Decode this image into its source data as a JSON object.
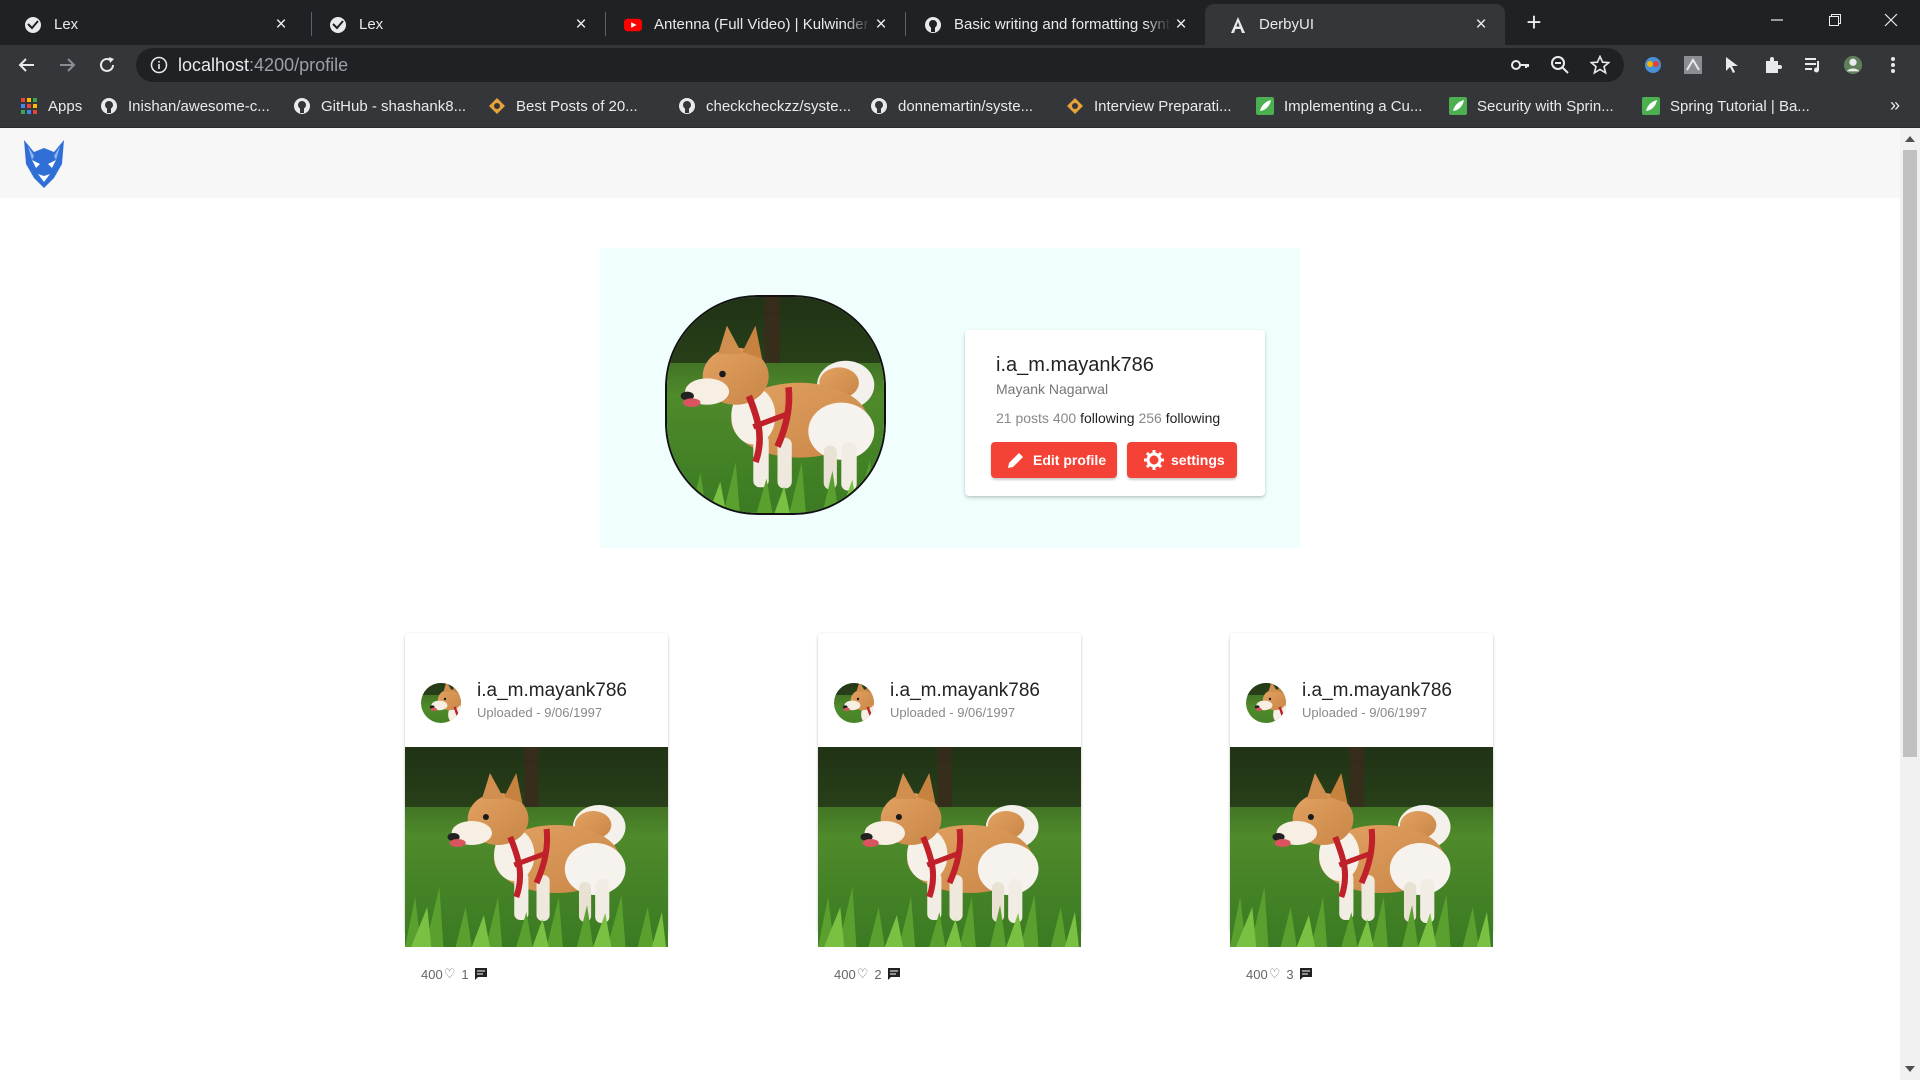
{
  "browser": {
    "tabs": [
      {
        "title": "Lex",
        "icon": "lex-icon"
      },
      {
        "title": "Lex",
        "icon": "lex-icon"
      },
      {
        "title": "Antenna (Full Video) | Kulwinder Billa",
        "icon": "youtube-icon"
      },
      {
        "title": "Basic writing and formatting syntax",
        "icon": "github-icon"
      },
      {
        "title": "DerbyUI",
        "icon": "angular-icon",
        "active": true
      }
    ],
    "url_host": "localhost",
    "url_path": ":4200/profile",
    "bookmarks": [
      {
        "label": "Apps",
        "icon": "apps-grid-icon"
      },
      {
        "label": "Inishan/awesome-c...",
        "icon": "github-icon"
      },
      {
        "label": "GitHub - shashank8...",
        "icon": "github-icon"
      },
      {
        "label": "Best Posts of 20...",
        "icon": "blog-icon"
      },
      {
        "label": "checkcheckzz/syste...",
        "icon": "github-icon"
      },
      {
        "label": "donnemartin/syste...",
        "icon": "github-icon"
      },
      {
        "label": "Interview Preparati...",
        "icon": "blog-icon"
      },
      {
        "label": "Implementing a Cu...",
        "icon": "leaf-icon"
      },
      {
        "label": "Security with Sprin...",
        "icon": "leaf-icon"
      },
      {
        "label": "Spring Tutorial | Ba...",
        "icon": "leaf-icon"
      }
    ],
    "more_label": "»"
  },
  "profile": {
    "username": "i.a_m.mayank786",
    "full_name": "Mayank Nagarwal",
    "posts_count": "21",
    "posts_label": "posts",
    "followers_count": "400",
    "followers_label": "following",
    "following_count": "256",
    "following_label": "following",
    "edit_label": "Edit profile",
    "settings_label": "settings"
  },
  "posts": [
    {
      "username": "i.a_m.mayank786",
      "date": "Uploaded - 9/06/1997",
      "likes": "400",
      "comments": "1"
    },
    {
      "username": "i.a_m.mayank786",
      "date": "Uploaded - 9/06/1997",
      "likes": "400",
      "comments": "2"
    },
    {
      "username": "i.a_m.mayank786",
      "date": "Uploaded - 9/06/1997",
      "likes": "400",
      "comments": "3"
    }
  ],
  "colors": {
    "accent": "#f44336",
    "panel_bg": "#f0fefe",
    "logo_blue": "#2f6fd6"
  }
}
